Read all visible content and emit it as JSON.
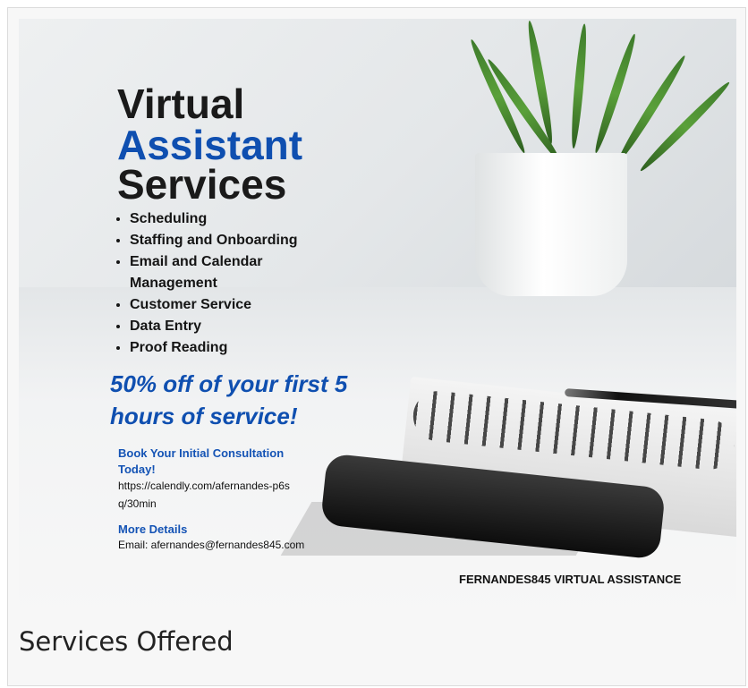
{
  "flyer": {
    "title_line1": "Virtual",
    "title_line2": "Assistant",
    "title_line3": "Services",
    "services": [
      "Scheduling",
      "Staffing and Onboarding",
      "Email and Calendar Management",
      "Customer Service",
      "Data Entry",
      "Proof Reading"
    ],
    "promo": "50% off of your first 5 hours of service!",
    "consult_heading": "Book Your Initial Consultation Today!",
    "consult_link": "https://calendly.com/afernandes-p6sq/30min",
    "more_heading": "More Details",
    "email": "Email: afernandes@fernandes845.com",
    "brand": "FERNANDES845 VIRTUAL ASSISTANCE"
  },
  "caption": "Services Offered",
  "colors": {
    "accent_blue": "#0f4fb0",
    "text_dark": "#1a1a1a"
  }
}
